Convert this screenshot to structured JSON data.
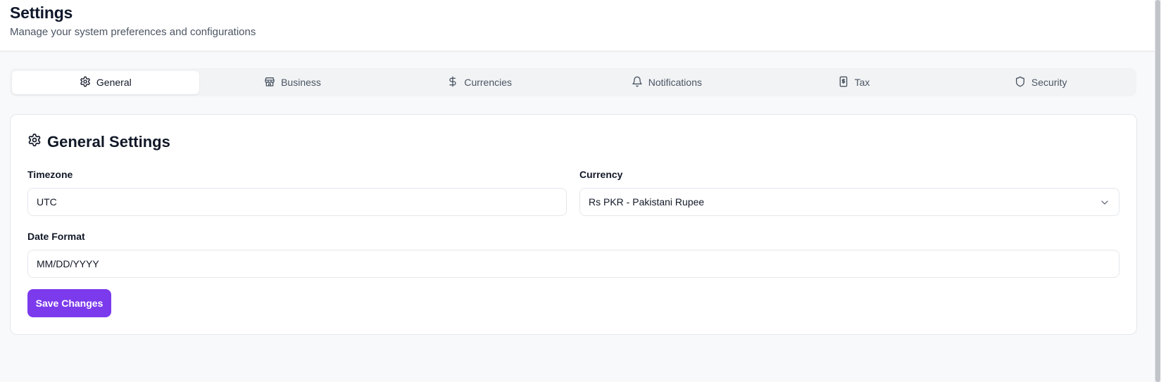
{
  "header": {
    "title": "Settings",
    "subtitle": "Manage your system preferences and configurations"
  },
  "tabs": [
    {
      "label": "General",
      "icon": "gear-icon",
      "active": true
    },
    {
      "label": "Business",
      "icon": "store-icon",
      "active": false
    },
    {
      "label": "Currencies",
      "icon": "dollar-icon",
      "active": false
    },
    {
      "label": "Notifications",
      "icon": "bell-icon",
      "active": false
    },
    {
      "label": "Tax",
      "icon": "receipt-icon",
      "active": false
    },
    {
      "label": "Security",
      "icon": "shield-icon",
      "active": false
    }
  ],
  "general": {
    "title": "General Settings",
    "timezone_label": "Timezone",
    "timezone_value": "UTC",
    "currency_label": "Currency",
    "currency_value": "Rs PKR - Pakistani Rupee",
    "date_format_label": "Date Format",
    "date_format_value": "MM/DD/YYYY",
    "save_label": "Save Changes"
  },
  "colors": {
    "accent": "#7c3aed",
    "page_bg": "#f8f9fb",
    "tab_bg": "#f1f3f5"
  }
}
